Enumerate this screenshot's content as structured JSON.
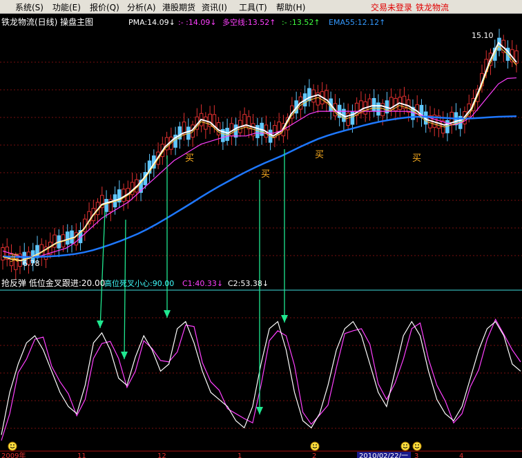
{
  "menu": {
    "items": [
      "系统(S)",
      "功能(E)",
      "报价(Q)",
      "分析(A)",
      "港股期货",
      "资讯(I)",
      "工具(T)",
      "帮助(H)"
    ],
    "login_status": "交易未登录",
    "stock_name": "铁龙物流"
  },
  "main_chart": {
    "title": "铁龙物流(日线) 操盘主图",
    "indicators": [
      {
        "text": "PMA:14.09↓",
        "color": "#ffffff"
      },
      {
        "text": ":- :14.09↓",
        "color": "#ff40ff"
      },
      {
        "text": "多空线:13.52↑",
        "color": "#ff40ff"
      },
      {
        "text": ":- :13.52↑",
        "color": "#40ff40"
      },
      {
        "text": "EMA55:12.12↑",
        "color": "#3399ff"
      }
    ],
    "high_label": "15.10",
    "low_label": "6.78",
    "buy_labels": [
      "买",
      "买",
      "买",
      "买",
      "买"
    ]
  },
  "sub_chart": {
    "title": "抢反弹 低位金叉跟进:20.00",
    "indicators": [
      {
        "text": "高位死叉小心:90.00",
        "color": "#40ffff"
      },
      {
        "text": "C1:40.33↓",
        "color": "#ff40ff"
      },
      {
        "text": "C2:53.38↓",
        "color": "#ffffff"
      }
    ]
  },
  "axis": {
    "dates": [
      "2009年",
      "11",
      "12",
      "1",
      "2",
      "2010/02/22/一",
      "3",
      "4"
    ]
  },
  "colors": {
    "background": "#000000",
    "up_candle": "#e03030",
    "down_candle": "#60c8ff",
    "pma": "#ffffff",
    "sub_line": "#ff40ff",
    "long_short": "#ff40ff",
    "ema55": "#1e78ff",
    "yellow_line": "#ffd23c",
    "arrows": "#20e890",
    "grid": "#7a1010",
    "buy": "#ffb020",
    "divider": "#40e0e0"
  },
  "chart_data": {
    "type": "line",
    "title": "铁龙物流(日线) 操盘主图",
    "y_range": [
      6.78,
      15.1
    ],
    "series": [
      {
        "name": "PMA",
        "values": [
          7.0,
          6.9,
          6.85,
          6.95,
          7.1,
          7.3,
          7.5,
          7.6,
          7.7,
          8.0,
          8.5,
          8.9,
          9.0,
          9.1,
          9.3,
          9.6,
          10.0,
          10.5,
          11.0,
          11.3,
          11.5,
          11.6,
          12.0,
          11.9,
          11.6,
          11.5,
          11.7,
          11.8,
          11.7,
          11.6,
          11.4,
          11.6,
          12.2,
          12.6,
          12.8,
          12.9,
          12.7,
          12.3,
          12.1,
          12.2,
          12.4,
          12.5,
          12.5,
          12.4,
          12.6,
          12.5,
          12.3,
          12.0,
          11.9,
          11.8,
          11.9,
          12.0,
          12.4,
          13.2,
          14.1,
          14.8,
          14.5,
          14.09
        ]
      },
      {
        "name": "多空线",
        "values": [
          7.2,
          7.1,
          7.0,
          7.0,
          7.0,
          7.1,
          7.2,
          7.3,
          7.5,
          7.8,
          8.1,
          8.4,
          8.6,
          8.8,
          9.0,
          9.3,
          9.6,
          9.9,
          10.2,
          10.5,
          10.7,
          10.9,
          11.1,
          11.2,
          11.3,
          11.4,
          11.4,
          11.4,
          11.5,
          11.5,
          11.5,
          11.6,
          11.8,
          12.0,
          12.2,
          12.3,
          12.3,
          12.3,
          12.3,
          12.3,
          12.3,
          12.3,
          12.3,
          12.3,
          12.3,
          12.3,
          12.2,
          12.1,
          12.0,
          11.9,
          11.8,
          11.9,
          12.1,
          12.5,
          12.9,
          13.3,
          13.5,
          13.52
        ]
      },
      {
        "name": "EMA55",
        "values": [
          7.0,
          6.99,
          6.98,
          6.98,
          6.99,
          7.0,
          7.02,
          7.05,
          7.09,
          7.15,
          7.23,
          7.33,
          7.44,
          7.56,
          7.69,
          7.83,
          7.99,
          8.17,
          8.36,
          8.56,
          8.76,
          8.96,
          9.17,
          9.37,
          9.56,
          9.74,
          9.92,
          10.09,
          10.25,
          10.4,
          10.54,
          10.68,
          10.84,
          11.0,
          11.15,
          11.29,
          11.41,
          11.51,
          11.6,
          11.69,
          11.78,
          11.86,
          11.93,
          11.99,
          12.04,
          12.08,
          12.1,
          12.1,
          12.08,
          12.06,
          12.04,
          12.03,
          12.04,
          12.06,
          12.08,
          12.1,
          12.11,
          12.12
        ]
      }
    ],
    "oscillator": {
      "C1_last": 40.33,
      "C2_last": 53.38,
      "levels": [
        20.0,
        90.0
      ],
      "c2": [
        10,
        40,
        60,
        75,
        80,
        70,
        55,
        40,
        30,
        25,
        45,
        75,
        82,
        70,
        50,
        45,
        65,
        80,
        70,
        55,
        60,
        85,
        90,
        75,
        55,
        40,
        35,
        30,
        20,
        15,
        30,
        60,
        85,
        90,
        70,
        40,
        20,
        15,
        25,
        45,
        70,
        85,
        90,
        80,
        60,
        40,
        30,
        55,
        80,
        90,
        80,
        55,
        35,
        25,
        20,
        30,
        50,
        70,
        85,
        90,
        80,
        60,
        55
      ]
    }
  }
}
